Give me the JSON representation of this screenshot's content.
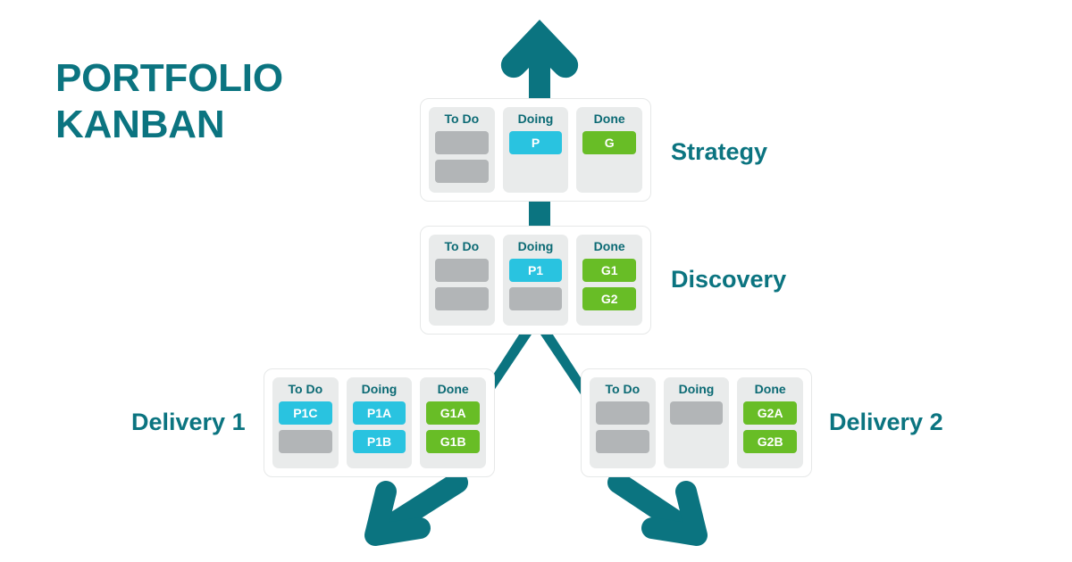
{
  "title": {
    "line1": "PORTFOLIO",
    "line2": "KANBAN"
  },
  "colors": {
    "teal": "#0b7480",
    "heading_teal": "#0b6a74",
    "card_blue": "#29c3e0",
    "card_green": "#68bd26",
    "card_empty_gray": "#b2b5b7",
    "column_gray": "#e9ebeb",
    "board_bg": "#ffffff",
    "background": "#ffffff"
  },
  "labels": {
    "strategy": "Strategy",
    "discovery": "Discovery",
    "delivery1": "Delivery 1",
    "delivery2": "Delivery 2"
  },
  "boards": {
    "strategy": {
      "name": "Strategy",
      "columns": [
        {
          "title": "To Do",
          "cards": [
            {
              "label": "",
              "type": "empty"
            },
            {
              "label": "",
              "type": "empty"
            }
          ]
        },
        {
          "title": "Doing",
          "cards": [
            {
              "label": "P",
              "type": "blue"
            }
          ]
        },
        {
          "title": "Done",
          "cards": [
            {
              "label": "G",
              "type": "green"
            }
          ]
        }
      ]
    },
    "discovery": {
      "name": "Discovery",
      "columns": [
        {
          "title": "To Do",
          "cards": [
            {
              "label": "",
              "type": "empty"
            },
            {
              "label": "",
              "type": "empty"
            }
          ]
        },
        {
          "title": "Doing",
          "cards": [
            {
              "label": "P1",
              "type": "blue"
            },
            {
              "label": "",
              "type": "empty"
            }
          ]
        },
        {
          "title": "Done",
          "cards": [
            {
              "label": "G1",
              "type": "green"
            },
            {
              "label": "G2",
              "type": "green"
            }
          ]
        }
      ]
    },
    "delivery1": {
      "name": "Delivery 1",
      "columns": [
        {
          "title": "To Do",
          "cards": [
            {
              "label": "P1C",
              "type": "blue"
            },
            {
              "label": "",
              "type": "empty"
            }
          ]
        },
        {
          "title": "Doing",
          "cards": [
            {
              "label": "P1A",
              "type": "blue"
            },
            {
              "label": "P1B",
              "type": "blue"
            }
          ]
        },
        {
          "title": "Done",
          "cards": [
            {
              "label": "G1A",
              "type": "green"
            },
            {
              "label": "G1B",
              "type": "green"
            }
          ]
        }
      ]
    },
    "delivery2": {
      "name": "Delivery 2",
      "columns": [
        {
          "title": "To Do",
          "cards": [
            {
              "label": "",
              "type": "empty"
            },
            {
              "label": "",
              "type": "empty"
            }
          ]
        },
        {
          "title": "Doing",
          "cards": [
            {
              "label": "",
              "type": "empty"
            }
          ]
        },
        {
          "title": "Done",
          "cards": [
            {
              "label": "G2A",
              "type": "green"
            },
            {
              "label": "G2B",
              "type": "green"
            }
          ]
        }
      ]
    }
  },
  "arrows": [
    {
      "name": "arrow-up-to-strategy",
      "direction": "up"
    },
    {
      "name": "connector-strategy-discovery",
      "direction": "down"
    },
    {
      "name": "arrow-discovery-to-delivery1",
      "direction": "down-left"
    },
    {
      "name": "arrow-discovery-to-delivery2",
      "direction": "down-right"
    },
    {
      "name": "arrow-out-of-delivery1",
      "direction": "down-left"
    },
    {
      "name": "arrow-out-of-delivery2",
      "direction": "down-right"
    }
  ]
}
